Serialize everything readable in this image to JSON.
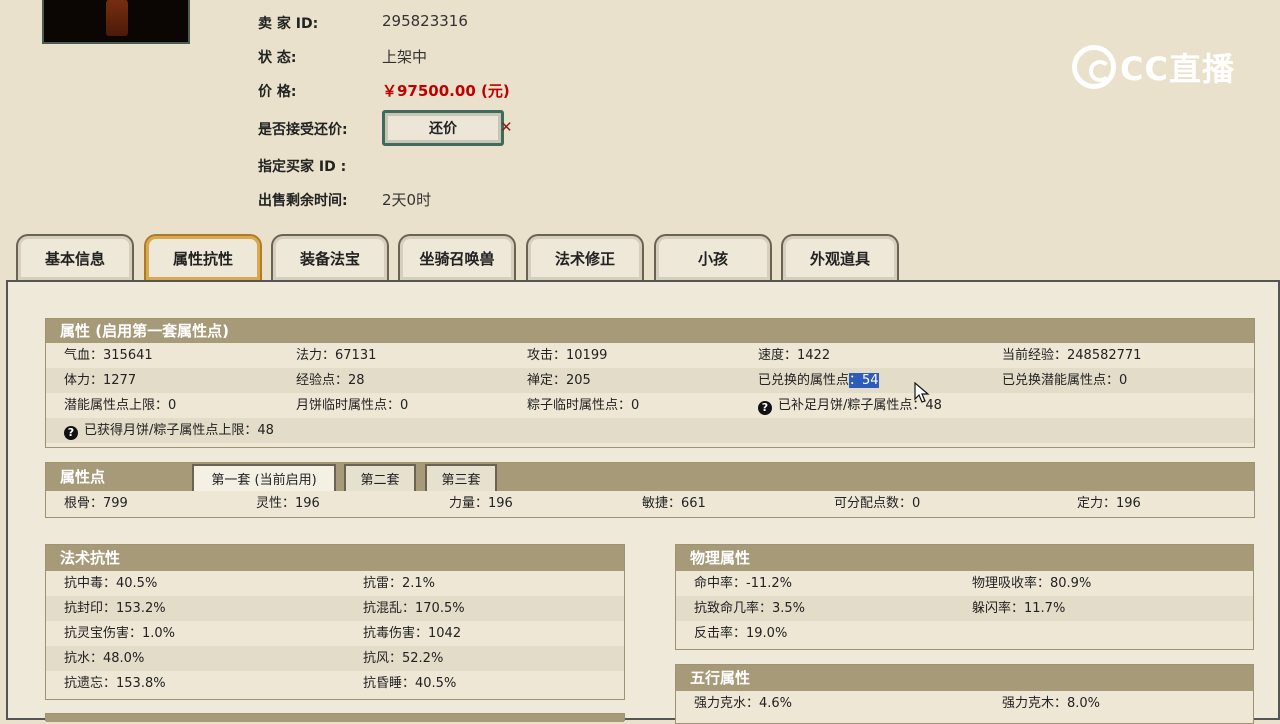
{
  "seller": {
    "id_label": "卖  家    ID:",
    "id_value": "295823316",
    "status_label": "状        态:",
    "status_value": "上架中",
    "price_label": "价        格:",
    "price_value": "￥97500.00 (元)",
    "bargain_label": "是否接受还价:",
    "bargain_button": "还价",
    "buyer_label": "指定买家 ID :",
    "time_label": "出售剩余时间:",
    "time_value": "2天0时"
  },
  "logo": {
    "text": "CC直播"
  },
  "tabs": [
    "基本信息",
    "属性抗性",
    "装备法宝",
    "坐骑召唤兽",
    "法术修正",
    "小孩",
    "外观道具"
  ],
  "active_tab": 1,
  "attributes": {
    "title": "属性 (启用第一套属性点)",
    "rows": [
      [
        "气血：315641",
        "法力：67131",
        "攻击：10199",
        "速度：1422",
        "当前经验：248582771"
      ],
      [
        "体力：1277",
        "经验点：28",
        "禅定：205",
        "已兑换的属性点",
        "已兑换潜能属性点：0"
      ],
      [
        "潜能属性点上限：0",
        "月饼临时属性点：0",
        "粽子临时属性点：0",
        "已补足月饼/粽子属性点：48",
        ""
      ],
      [
        "已获得月饼/粽子属性点上限：48"
      ]
    ],
    "exchanged_value": "：54"
  },
  "points": {
    "title": "属性点",
    "subtabs": [
      "第一套 (当前启用)",
      "第二套",
      "第三套"
    ],
    "row": [
      "根骨：799",
      "灵性：196",
      "力量：196",
      "敏捷：661",
      "可分配点数：0",
      "定力：196"
    ]
  },
  "magic_resist": {
    "title": "法术抗性",
    "rows": [
      [
        "抗中毒：40.5%",
        "抗雷：2.1%"
      ],
      [
        "抗封印：153.2%",
        "抗混乱：170.5%"
      ],
      [
        "抗灵宝伤害：1.0%",
        "抗毒伤害：1042"
      ],
      [
        "抗水：48.0%",
        "抗风：52.2%"
      ],
      [
        "抗遗忘：153.8%",
        "抗昏睡：40.5%"
      ]
    ]
  },
  "physical": {
    "title": "物理属性",
    "rows": [
      [
        "命中率：-11.2%",
        "物理吸收率：80.9%"
      ],
      [
        "抗致命几率：3.5%",
        "躲闪率：11.7%"
      ],
      [
        "反击率：19.0%",
        ""
      ]
    ]
  },
  "five_elements": {
    "title": "五行属性",
    "rows": [
      [
        "强力克水：4.6%",
        "强力克木：8.0%"
      ]
    ]
  }
}
